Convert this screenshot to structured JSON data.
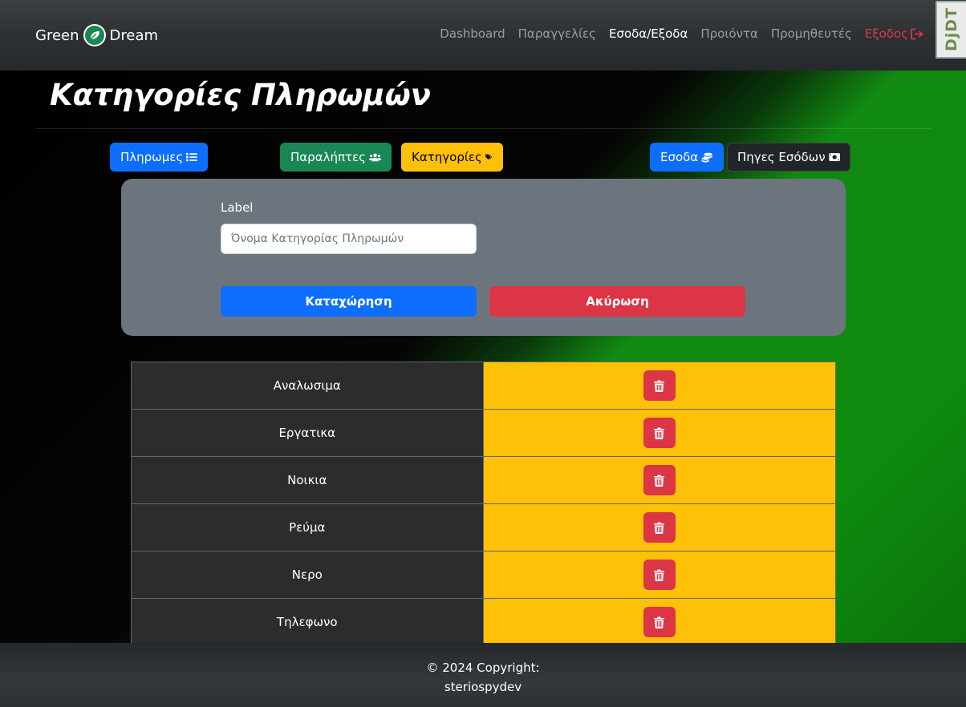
{
  "brand": {
    "left": "Green",
    "right": "Dream",
    "icon": "leaf-icon"
  },
  "nav": {
    "items": [
      {
        "label": "Dashboard"
      },
      {
        "label": "Παραγγελίες"
      },
      {
        "label": "Εσοδα/Εξοδα"
      },
      {
        "label": "Προιόντα"
      },
      {
        "label": "Προμηθευτές"
      },
      {
        "label": "Εξοδος"
      }
    ],
    "active": "Εσοδα/Εξοδα"
  },
  "debug_toolbar": {
    "label": "DjDT"
  },
  "page": {
    "title": "Κατηγορίες Πληρωμών"
  },
  "actions": {
    "payments": {
      "label": "Πληρωμες",
      "icon": "list-icon"
    },
    "payees": {
      "label": "Παραλήπτες",
      "icon": "users-icon"
    },
    "categories": {
      "label": "Κατηγορίες",
      "icon": "tags-icon"
    },
    "income": {
      "label": "Εσοδα",
      "icon": "coins-icon"
    },
    "income_sources": {
      "label": "Πηγες Εσόδων",
      "icon": "money-bill-icon"
    }
  },
  "form": {
    "field_label": "Label",
    "field_value": "",
    "field_placeholder": "Όνομα Κατηγορίας Πληρωμών",
    "submit_label": "Καταχώρηση",
    "cancel_label": "Ακύρωση"
  },
  "categories": [
    {
      "name": "Αναλωσιμα"
    },
    {
      "name": "Εργατικα"
    },
    {
      "name": "Νοικια"
    },
    {
      "name": "Ρεύμα"
    },
    {
      "name": "Νερο"
    },
    {
      "name": "Τηλεφωνο"
    }
  ],
  "footer": {
    "line1": "© 2024 Copyright:",
    "line2": "steriospydev"
  },
  "colors": {
    "primary": "#0d6efd",
    "success": "#198754",
    "warning": "#ffc107",
    "danger": "#dc3545",
    "dark": "#212529",
    "card": "#6c757d"
  }
}
